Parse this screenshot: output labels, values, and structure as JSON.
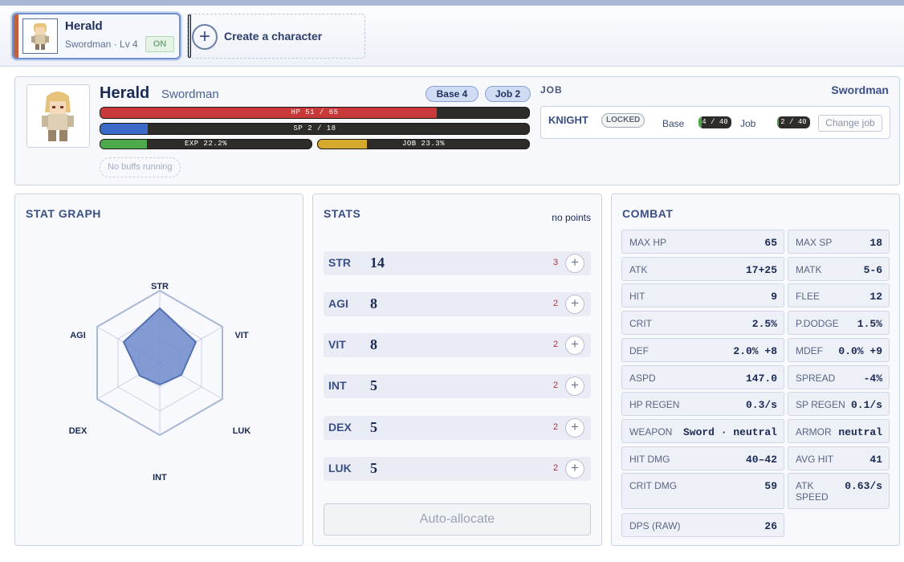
{
  "tabs": {
    "char_name": "Herald",
    "char_sub": "Swordman · Lv 4",
    "char_status": "ON",
    "create_label": "Create a character"
  },
  "header": {
    "name": "Herald",
    "class": "Swordman",
    "base_pill": "Base 4",
    "job_pill": "Job 2",
    "hp": {
      "text": "HP 51 / 65",
      "fraction": 0.785,
      "color": "#c83a3a"
    },
    "sp": {
      "text": "SP 2 / 18",
      "fraction": 0.111,
      "color": "#3a6ac8"
    },
    "exp": {
      "text": "EXP 22.2%",
      "fraction": 0.222,
      "color": "#4caa4c"
    },
    "jobexp": {
      "text": "JOB 23.3%",
      "fraction": 0.233,
      "color": "#d4a92c"
    },
    "buffs": "No buffs running"
  },
  "job": {
    "label": "JOB",
    "value": "Swordman",
    "next": "KNIGHT",
    "locked": "LOCKED",
    "base_label": "Base",
    "base_req": "4 / 40",
    "base_fraction": 0.1,
    "job_label": "Job",
    "job_req": "2 / 40",
    "job_fraction": 0.05,
    "change_button": "Change job"
  },
  "graph": {
    "title": "STAT GRAPH",
    "axes": [
      "STR",
      "VIT",
      "LUK",
      "INT",
      "DEX",
      "AGI"
    ]
  },
  "stats": {
    "title": "STATS",
    "points_label": "no points",
    "auto_label": "Auto-allocate",
    "rows": [
      {
        "key": "STR",
        "value": "14",
        "cost": "3"
      },
      {
        "key": "AGI",
        "value": "8",
        "cost": "2"
      },
      {
        "key": "VIT",
        "value": "8",
        "cost": "2"
      },
      {
        "key": "INT",
        "value": "5",
        "cost": "2"
      },
      {
        "key": "DEX",
        "value": "5",
        "cost": "2"
      },
      {
        "key": "LUK",
        "value": "5",
        "cost": "2"
      }
    ]
  },
  "combat": {
    "title": "COMBAT",
    "left": [
      {
        "k": "MAX HP",
        "v": "65"
      },
      {
        "k": "ATK",
        "v": "17+25"
      },
      {
        "k": "HIT",
        "v": "9"
      },
      {
        "k": "CRIT",
        "v": "2.5%"
      },
      {
        "k": "DEF",
        "v": "2.0% +8"
      },
      {
        "k": "ASPD",
        "v": "147.0"
      },
      {
        "k": "HP REGEN",
        "v": "0.3/s"
      },
      {
        "k": "WEAPON",
        "v": "Sword · neutral"
      },
      {
        "k": "HIT DMG",
        "v": "40–42"
      },
      {
        "k": "CRIT DMG",
        "v": "59"
      },
      {
        "k": "DPS (RAW)",
        "v": "26"
      }
    ],
    "right": [
      {
        "k": "MAX SP",
        "v": "18"
      },
      {
        "k": "MATK",
        "v": "5-6"
      },
      {
        "k": "FLEE",
        "v": "12"
      },
      {
        "k": "P.DODGE",
        "v": "1.5%"
      },
      {
        "k": "MDEF",
        "v": "0.0% +9"
      },
      {
        "k": "SPREAD",
        "v": "-4%"
      },
      {
        "k": "SP REGEN",
        "v": "0.1/s"
      },
      {
        "k": "ARMOR",
        "v": "neutral"
      },
      {
        "k": "AVG HIT",
        "v": "41"
      },
      {
        "k": "ATK SPEED",
        "v": "0.63/s"
      }
    ]
  }
}
